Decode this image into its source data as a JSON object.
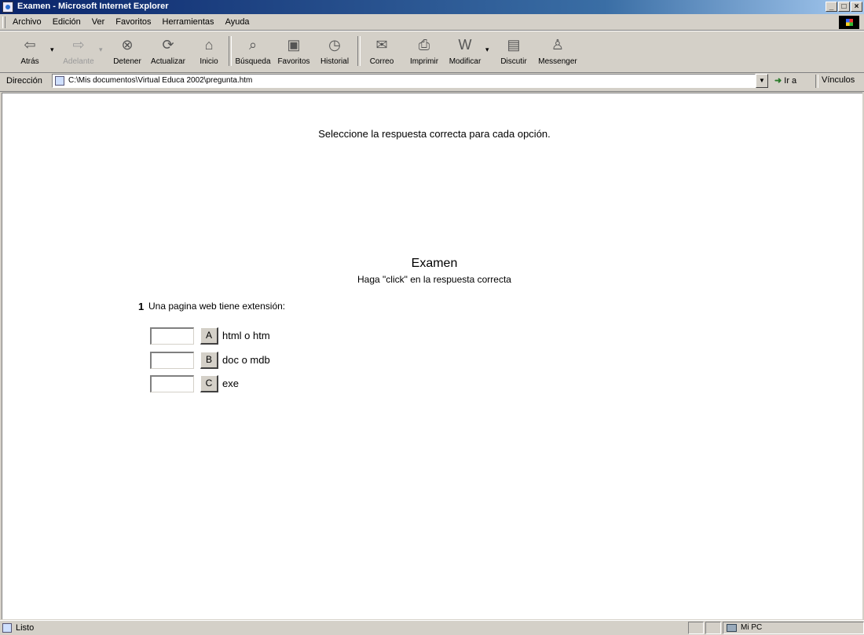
{
  "window": {
    "title": "Examen - Microsoft Internet Explorer",
    "controls": {
      "minimize": "_",
      "maximize": "□",
      "close": "×"
    }
  },
  "menu": [
    "Archivo",
    "Edición",
    "Ver",
    "Favoritos",
    "Herramientas",
    "Ayuda"
  ],
  "toolbar": {
    "back": "Atrás",
    "forward": "Adelante",
    "stop": "Detener",
    "refresh": "Actualizar",
    "home": "Inicio",
    "search": "Búsqueda",
    "favorites": "Favoritos",
    "history": "Historial",
    "mail": "Correo",
    "print": "Imprimir",
    "edit": "Modificar",
    "discuss": "Discutir",
    "messenger": "Messenger"
  },
  "address": {
    "label": "Dirección",
    "url": "C:\\Mis documentos\\Virtual Educa 2002\\pregunta.htm",
    "go": "Ir a",
    "links": "Vínculos"
  },
  "page": {
    "instructions": "Seleccione la respuesta correcta para cada opción.",
    "title": "Examen",
    "subtitle": "Haga \"click\" en la respuesta correcta",
    "question_number": "1",
    "question_text": "Una pagina web tiene extensión:",
    "options": [
      {
        "button": "A",
        "text": "html o htm",
        "answer": ""
      },
      {
        "button": "B",
        "text": "doc o mdb",
        "answer": ""
      },
      {
        "button": "C",
        "text": "exe",
        "answer": ""
      }
    ]
  },
  "status": {
    "text": "Listo",
    "zone": "Mi PC"
  }
}
